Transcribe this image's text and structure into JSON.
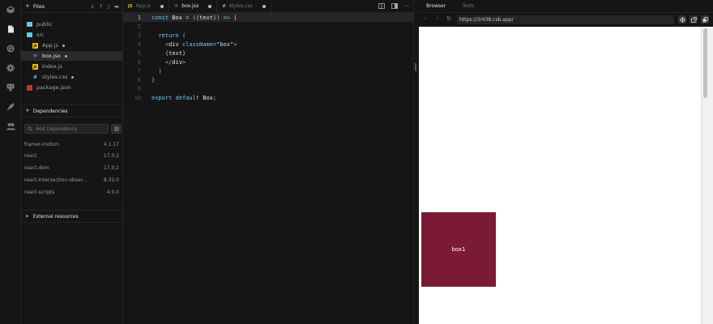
{
  "activity_bar": {
    "icons": [
      "codesandbox-logo-icon",
      "file-icon",
      "search-icon",
      "gear-icon",
      "github-icon",
      "rocket-icon",
      "users-icon"
    ]
  },
  "sidebar": {
    "files_header": "Files",
    "tree": [
      {
        "name": "public",
        "type": "folder",
        "modified": false
      },
      {
        "name": "src",
        "type": "folder",
        "modified": false
      },
      {
        "name": "App.js",
        "type": "js",
        "modified": true
      },
      {
        "name": "box.jsx",
        "type": "jsx",
        "modified": true,
        "active": true
      },
      {
        "name": "index.js",
        "type": "js",
        "modified": false
      },
      {
        "name": "styles.css",
        "type": "css",
        "modified": true
      },
      {
        "name": "package.json",
        "type": "json",
        "modified": false
      }
    ],
    "dependencies_header": "Dependencies",
    "dependency_placeholder": "Add Dependency",
    "dependencies": [
      {
        "name": "framer-motion",
        "version": "4.1.17"
      },
      {
        "name": "react",
        "version": "17.0.2"
      },
      {
        "name": "react-dom",
        "version": "17.0.2"
      },
      {
        "name": "react-intersection-obser...",
        "version": "8.32.0"
      },
      {
        "name": "react-scripts",
        "version": "4.0.0"
      }
    ],
    "external_header": "External resources"
  },
  "editor": {
    "tabs": [
      {
        "label": "App.js",
        "icon": "JS",
        "active": false,
        "dirty": true
      },
      {
        "label": "box.jsx",
        "icon": "⚛",
        "active": true,
        "dirty": true
      },
      {
        "label": "styles.css",
        "icon": "#",
        "active": false,
        "dirty": true
      }
    ],
    "line_numbers": [
      "1",
      "2",
      "3",
      "4",
      "5",
      "6",
      "7",
      "8",
      "9",
      "10"
    ],
    "code": [
      "const Box = ({text}) => {",
      "",
      "  return (",
      "    <div className=\"box\">",
      "    {text}",
      "    </div>",
      "  )",
      "}",
      "",
      "export default Box;"
    ]
  },
  "preview": {
    "tabs": [
      "Browser",
      "Tests"
    ],
    "url": "https://3r438.csb.app/",
    "box_text": "box1",
    "box_color": "#7a1a35"
  }
}
